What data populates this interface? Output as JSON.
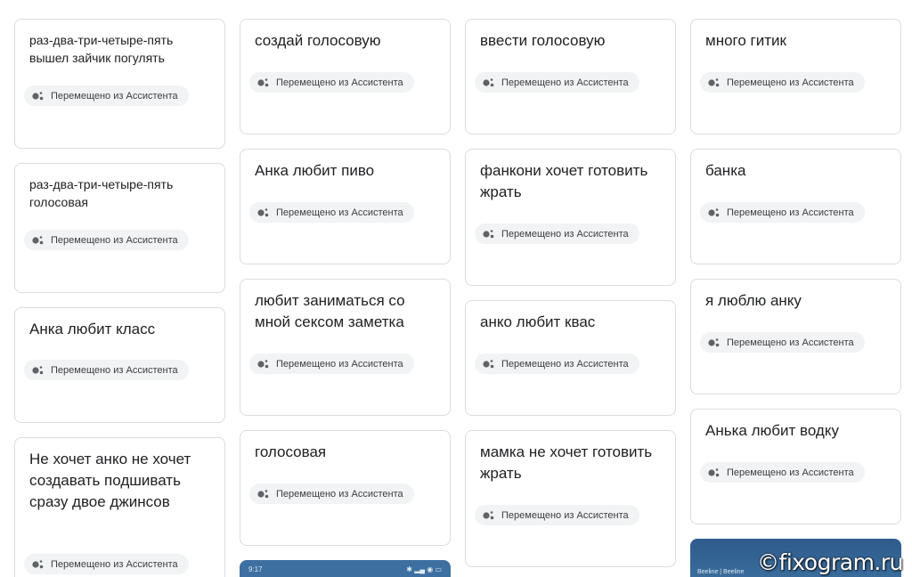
{
  "chip_label": "Перемещено из Ассистента",
  "columns": [
    [
      {
        "title": "раз-два-три-четыре-пять вышел зайчик погулять"
      },
      {
        "title": "раз-два-три-четыре-пять голосовая"
      },
      {
        "title": "Анка любит класс"
      },
      {
        "title": "Не хочет анко не хочет создавать подшивать сразу двое джинсов"
      }
    ],
    [
      {
        "title": "создай голосовую"
      },
      {
        "title": "Анка любит пиво"
      },
      {
        "title": "любит заниматься со мной сексом заметка"
      },
      {
        "title": "голосовая"
      }
    ],
    [
      {
        "title": "ввести голосовую"
      },
      {
        "title": "фанкони хочет готовить жрать"
      },
      {
        "title": "анко любит квас"
      },
      {
        "title": "мамка не хочет готовить жрать"
      }
    ],
    [
      {
        "title": "много гитик"
      },
      {
        "title": "банка"
      },
      {
        "title": "я люблю анку"
      },
      {
        "title": "Анька любит водку"
      }
    ]
  ],
  "thumbs": {
    "phone_status_time": "9:17",
    "beeline_text": "Beeline | Beeline"
  },
  "watermark": "©fixogram.ru",
  "colors": {
    "card_border": "#dadce0",
    "chip_bg": "#f1f3f4",
    "assistant_dot_dark": "#5f6368",
    "thumb_blue": "#3d6fa0"
  }
}
